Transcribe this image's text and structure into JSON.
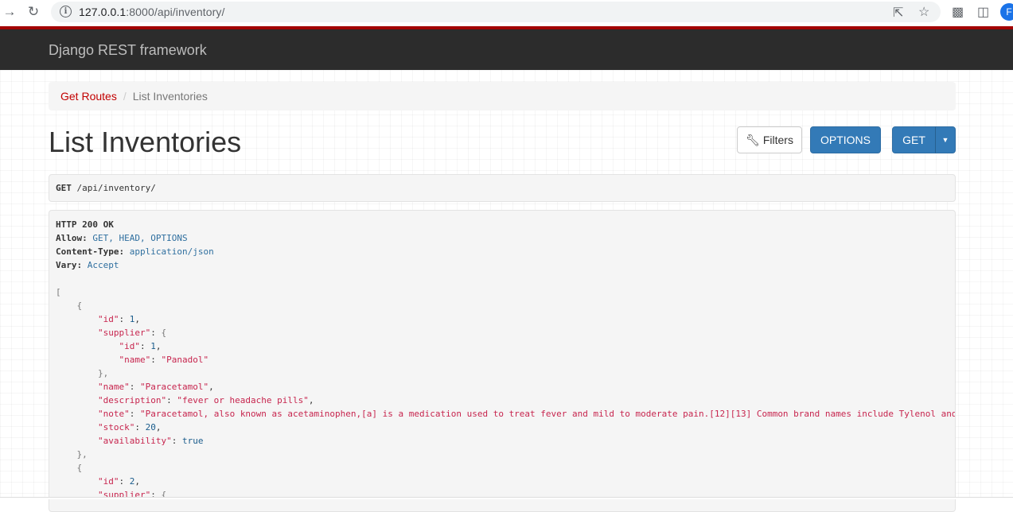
{
  "browser": {
    "url_host": "127.0.0.1",
    "url_rest": ":8000/api/inventory/",
    "avatar_letter": "F"
  },
  "navbar": {
    "brand": "Django REST framework"
  },
  "breadcrumb": {
    "items": [
      "Get Routes",
      "List Inventories"
    ]
  },
  "page": {
    "title": "List Inventories",
    "filters_label": "Filters",
    "options_label": "OPTIONS",
    "get_label": "GET"
  },
  "request": {
    "method": "GET",
    "path": "/api/inventory/"
  },
  "response": {
    "status": "HTTP 200 OK",
    "headers": [
      {
        "key": "Allow",
        "value": "GET, HEAD, OPTIONS"
      },
      {
        "key": "Content-Type",
        "value": "application/json"
      },
      {
        "key": "Vary",
        "value": "Accept"
      }
    ],
    "items": [
      {
        "id": "1",
        "supplier_id": "1",
        "supplier_name": "\"Panadol\"",
        "name": "\"Paracetamol\"",
        "description": "\"fever or headache pills\"",
        "note": "\"Paracetamol, also known as acetaminophen,[a] is a medication used to treat fever and mild to moderate pain.[12][13] Common brand names include Tylenol and Panadol.",
        "stock": "20",
        "availability": "true"
      },
      {
        "id": "2"
      }
    ]
  },
  "colors": {
    "navbar_bg": "#2c2c2c",
    "navbar_accent": "#a30000",
    "link": "#c20000",
    "primary": "#337ab7"
  }
}
